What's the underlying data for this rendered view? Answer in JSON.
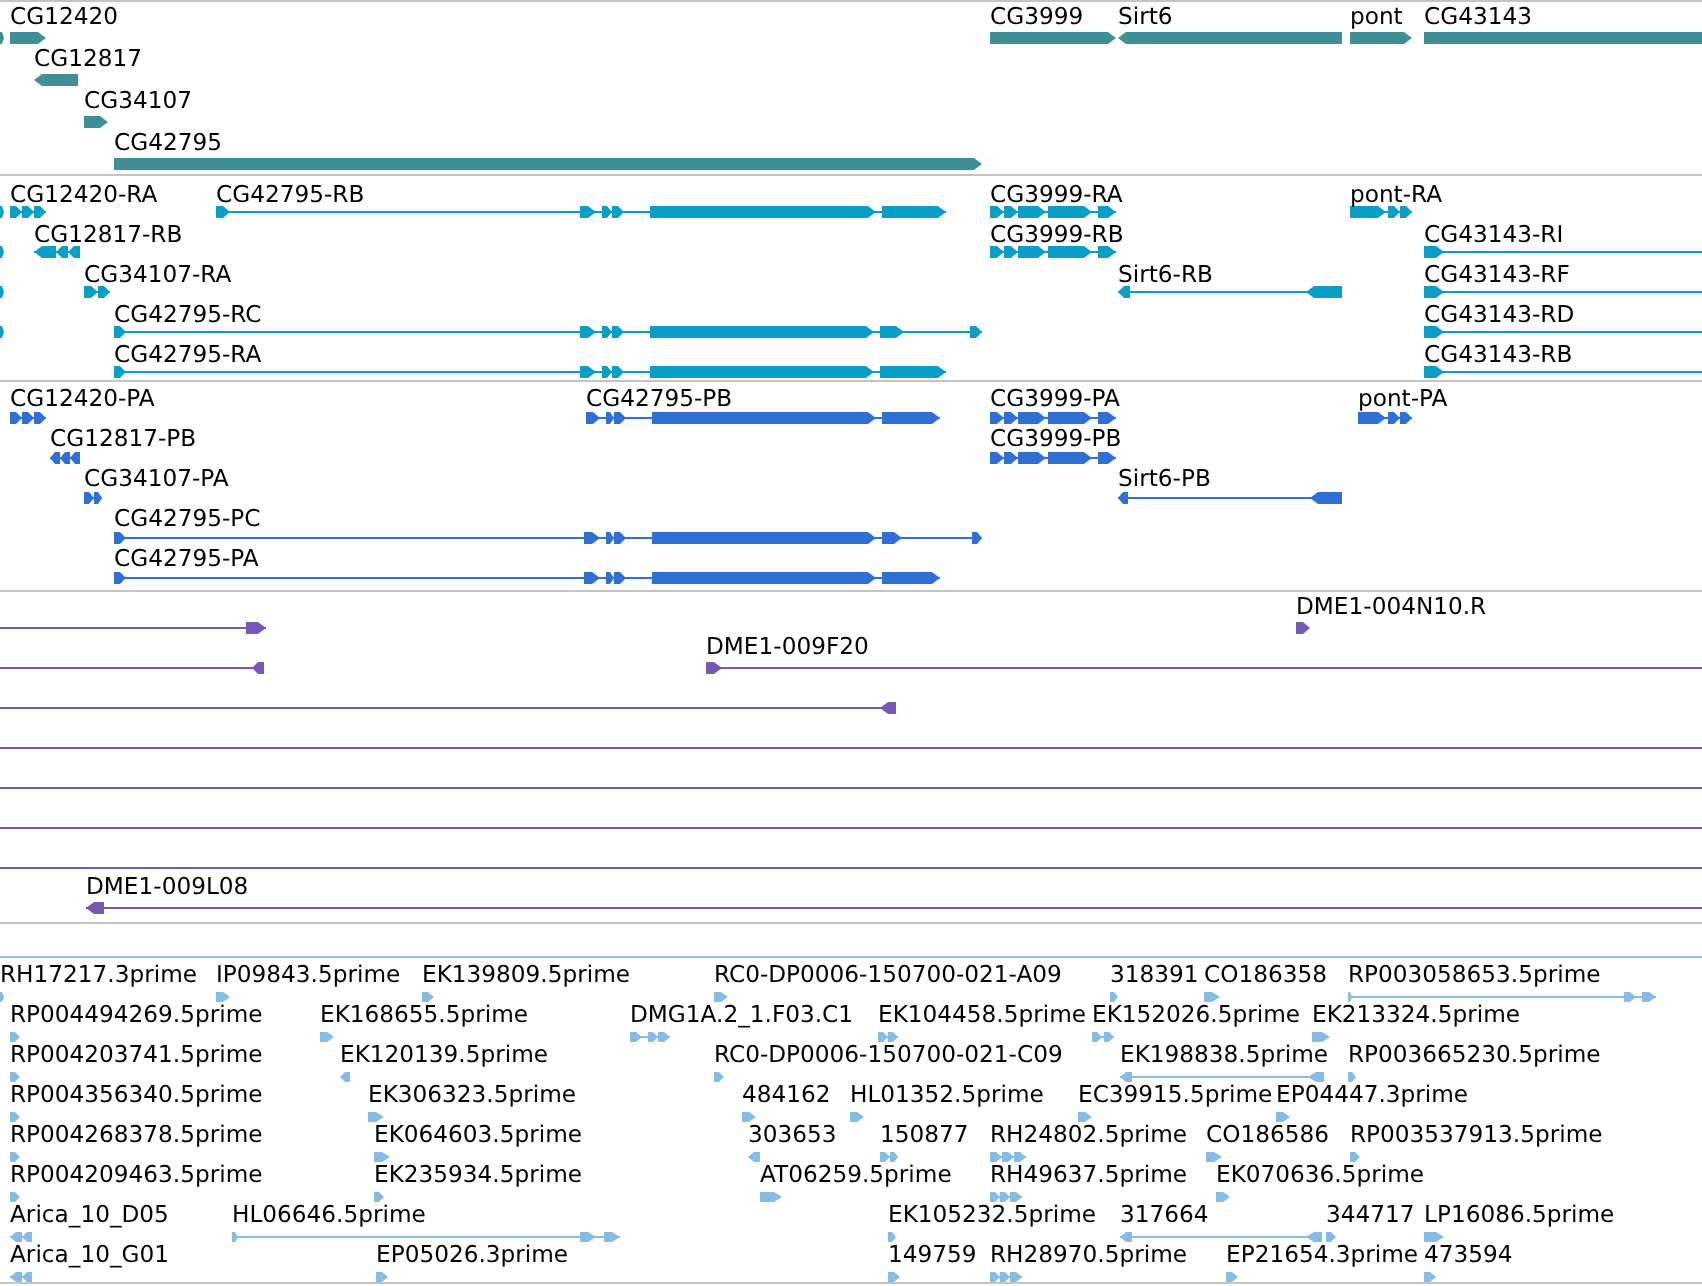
{
  "tracks": [
    {
      "kind": "gene",
      "features": [
        {
          "reverse": false
        },
        {
          "label": "CG12420",
          "reverse": false
        },
        {
          "label": "CG3999",
          "reverse": false
        },
        {
          "label": "Sirt6",
          "reverse": true
        },
        {
          "label": "pont",
          "reverse": false
        },
        {
          "label": "CG43143",
          "reverse": false
        },
        {
          "label": "CG12817",
          "reverse": true
        },
        {
          "label": "CG34107",
          "reverse": false
        },
        {
          "label": "CG42795",
          "reverse": false
        }
      ]
    },
    {
      "kind": "transcript",
      "features": [
        {
          "reverse": false
        },
        {
          "label": "CG12420-RA",
          "reverse": false
        },
        {
          "label": "CG42795-RB",
          "reverse": false
        },
        {
          "label": "CG3999-RA",
          "reverse": false
        },
        {
          "label": "pont-RA",
          "reverse": false
        },
        {
          "reverse": false
        },
        {
          "label": "CG12817-RB",
          "reverse": true
        },
        {
          "label": "CG3999-RB",
          "reverse": false
        },
        {
          "label": "CG43143-RI",
          "reverse": false
        },
        {
          "reverse": false
        },
        {
          "label": "CG34107-RA",
          "reverse": false
        },
        {
          "label": "Sirt6-RB",
          "reverse": true
        },
        {
          "label": "CG43143-RF",
          "reverse": false
        },
        {
          "reverse": false
        },
        {
          "label": "CG42795-RC",
          "reverse": false
        },
        {
          "label": "CG43143-RD",
          "reverse": false
        },
        {
          "label": "CG42795-RA",
          "reverse": false
        },
        {
          "label": "CG43143-RB",
          "reverse": false
        }
      ]
    },
    {
      "kind": "protein",
      "features": [
        {
          "label": "CG12420-PA",
          "reverse": false
        },
        {
          "label": "CG42795-PB",
          "reverse": false
        },
        {
          "label": "CG3999-PA",
          "reverse": false
        },
        {
          "label": "pont-PA",
          "reverse": false
        },
        {
          "label": "CG12817-PB",
          "reverse": true
        },
        {
          "label": "CG3999-PB",
          "reverse": false
        },
        {
          "label": "CG34107-PA",
          "reverse": false
        },
        {
          "label": "Sirt6-PB",
          "reverse": true
        },
        {
          "label": "CG42795-PC",
          "reverse": false
        },
        {
          "label": "CG42795-PA",
          "reverse": false
        }
      ]
    },
    {
      "kind": "clone",
      "features": [
        {
          "kind": "clone",
          "reverse": false
        },
        {
          "kind": "clone",
          "label": "DME1-004N10.R",
          "reverse": false
        },
        {
          "kind": "clone",
          "reverse": true
        },
        {
          "kind": "clone",
          "label": "DME1-009F20",
          "reverse": false
        },
        {
          "kind": "clone",
          "reverse": true
        },
        {
          "kind": "span"
        },
        {
          "kind": "span"
        },
        {
          "kind": "span"
        },
        {
          "kind": "span"
        },
        {
          "kind": "clone",
          "label": "DME1-009L08",
          "reverse": true
        }
      ]
    },
    {
      "kind": "est",
      "features": [
        {
          "label": "RH17217.3prime",
          "reverse": false
        },
        {
          "label": "IP09843.5prime",
          "reverse": false
        },
        {
          "label": "EK139809.5prime",
          "reverse": false
        },
        {
          "label": "RC0-DP0006-150700-021-A09",
          "reverse": false
        },
        {
          "label": "318391",
          "reverse": false
        },
        {
          "label": "CO186358",
          "reverse": false
        },
        {
          "label": "RP003058653.5prime",
          "reverse": false
        },
        {
          "label": "RP004494269.5prime",
          "reverse": false
        },
        {
          "label": "EK168655.5prime",
          "reverse": false
        },
        {
          "label": "DMG1A.2_1.F03.C1",
          "reverse": false
        },
        {
          "label": "EK104458.5prime",
          "reverse": false
        },
        {
          "label": "EK152026.5prime",
          "reverse": false
        },
        {
          "label": "EK213324.5prime",
          "reverse": false
        },
        {
          "label": "RP004203741.5prime",
          "reverse": false
        },
        {
          "label": "EK120139.5prime",
          "reverse": true
        },
        {
          "label": "RC0-DP0006-150700-021-C09",
          "reverse": false
        },
        {
          "label": "EK198838.5prime",
          "reverse": true
        },
        {
          "label": "RP003665230.5prime",
          "reverse": false
        },
        {
          "label": "RP004356340.5prime",
          "reverse": false
        },
        {
          "label": "EK306323.5prime",
          "reverse": false
        },
        {
          "label": "484162",
          "reverse": false
        },
        {
          "label": "HL01352.5prime",
          "reverse": false
        },
        {
          "label": "EC39915.5prime",
          "reverse": false
        },
        {
          "label": "EP04447.3prime",
          "reverse": false
        },
        {
          "label": "RP004268378.5prime",
          "reverse": false
        },
        {
          "label": "EK064603.5prime",
          "reverse": false
        },
        {
          "label": "303653",
          "reverse": true
        },
        {
          "label": "150877",
          "reverse": false
        },
        {
          "label": "RH24802.5prime",
          "reverse": false
        },
        {
          "label": "CO186586",
          "reverse": false
        },
        {
          "label": "RP003537913.5prime",
          "reverse": false
        },
        {
          "label": "RP004209463.5prime",
          "reverse": false
        },
        {
          "label": "EK235934.5prime",
          "reverse": false
        },
        {
          "label": "AT06259.5prime",
          "reverse": false
        },
        {
          "label": "RH49637.5prime",
          "reverse": false
        },
        {
          "label": "EK070636.5prime",
          "reverse": false
        },
        {
          "label": "Arica_10_D05",
          "reverse": true
        },
        {
          "label": "HL06646.5prime",
          "reverse": false
        },
        {
          "label": "EK105232.5prime",
          "reverse": false
        },
        {
          "label": "317664",
          "reverse": true
        },
        {
          "label": "344717",
          "reverse": false
        },
        {
          "label": "LP16086.5prime",
          "reverse": false
        },
        {
          "label": "Arica_10_G01",
          "reverse": true
        },
        {
          "label": "EP05026.3prime",
          "reverse": false
        },
        {
          "label": "149759",
          "reverse": false
        },
        {
          "label": "RH28970.5prime",
          "reverse": false
        },
        {
          "label": "EP21654.3prime",
          "reverse": false
        },
        {
          "label": "473594",
          "reverse": false
        }
      ]
    }
  ]
}
